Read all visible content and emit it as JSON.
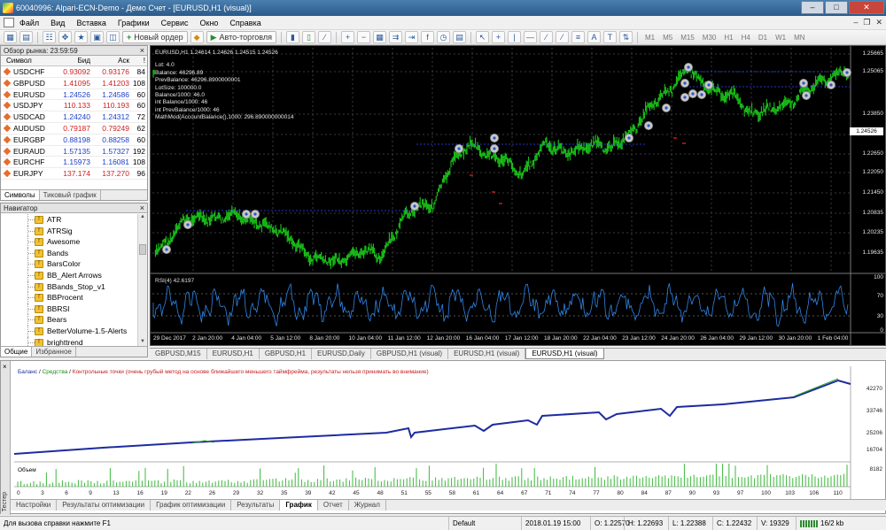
{
  "title_bar": {
    "title": "60040996: Alpari-ECN-Demo - Демо Счет - [EURUSD,H1 (visual)]"
  },
  "menu": [
    "Файл",
    "Вид",
    "Вставка",
    "Графики",
    "Сервис",
    "Окно",
    "Справка"
  ],
  "toolbar": {
    "new_order": "Новый ордер",
    "auto_trading": "Авто-торговля",
    "timeframes": [
      "M1",
      "M5",
      "M15",
      "M30",
      "H1",
      "H4",
      "D1",
      "W1",
      "MN"
    ]
  },
  "market_watch": {
    "title": "Обзор рынка: 23:59:59",
    "headers": {
      "symbol": "Символ",
      "bid": "Бид",
      "ask": "Аск",
      "spread": "!"
    },
    "rows": [
      {
        "symbol": "USDCHF",
        "bid": "0.93092",
        "ask": "0.93176",
        "spread": "84",
        "dir": "down"
      },
      {
        "symbol": "GBPUSD",
        "bid": "1.41095",
        "ask": "1.41203",
        "spread": "108",
        "dir": "down"
      },
      {
        "symbol": "EURUSD",
        "bid": "1.24526",
        "ask": "1.24586",
        "spread": "60",
        "dir": "up"
      },
      {
        "symbol": "USDJPY",
        "bid": "110.133",
        "ask": "110.193",
        "spread": "60",
        "dir": "down"
      },
      {
        "symbol": "USDCAD",
        "bid": "1.24240",
        "ask": "1.24312",
        "spread": "72",
        "dir": "up"
      },
      {
        "symbol": "AUDUSD",
        "bid": "0.79187",
        "ask": "0.79249",
        "spread": "62",
        "dir": "down"
      },
      {
        "symbol": "EURGBP",
        "bid": "0.88198",
        "ask": "0.88258",
        "spread": "60",
        "dir": "up"
      },
      {
        "symbol": "EURAUD",
        "bid": "1.57135",
        "ask": "1.57327",
        "spread": "192",
        "dir": "up"
      },
      {
        "symbol": "EURCHF",
        "bid": "1.15973",
        "ask": "1.16081",
        "spread": "108",
        "dir": "up"
      },
      {
        "symbol": "EURJPY",
        "bid": "137.174",
        "ask": "137.270",
        "spread": "96",
        "dir": "down"
      }
    ],
    "tabs": [
      "Символы",
      "Тиковый график"
    ]
  },
  "navigator": {
    "title": "Навигатор",
    "items": [
      "ATR",
      "ATRSig",
      "Awesome",
      "Bands",
      "BarsColor",
      "BB_Alert Arrows",
      "BBands_Stop_v1",
      "BBProcent",
      "BBRSI",
      "Bears",
      "BetterVolume-1.5-Alerts",
      "brighttrend"
    ],
    "tabs": [
      "Общие",
      "Избранное"
    ]
  },
  "chart": {
    "header": "EURUSD,H1  1.24614 1.24626 1.24515 1.24526",
    "info_lines": [
      "Lot: 4.0",
      "Balance: 46296.89",
      "PrevBalance: 46296.8900000001",
      "LotSize: 100000.0",
      "Balance/1000: 46.0",
      "int Balance/1000: 46",
      "int PrevBalance/1000: 46",
      "MathMod(AccountBalance(),1000: 296.890000000014"
    ],
    "rsi_label": "RSI(4) 42.6197",
    "price_labels": [
      "1.25665",
      "1.25065",
      "1.23850",
      "1.23245",
      "1.22650",
      "1.22050",
      "1.21450",
      "1.20835",
      "1.20235",
      "1.19635"
    ],
    "current_price": "1.24526",
    "rsi_scale": [
      "100",
      "70",
      "30",
      "0"
    ],
    "time_labels": [
      "29 Dec 2017",
      "2 Jan 20:00",
      "4 Jan 04:00",
      "5 Jan 12:00",
      "8 Jan 20:00",
      "10 Jan 04:00",
      "11 Jan 12:00",
      "12 Jan 20:00",
      "16 Jan 04:00",
      "17 Jan 12:00",
      "18 Jan 20:00",
      "22 Jan 04:00",
      "23 Jan 12:00",
      "24 Jan 20:00",
      "26 Jan 04:00",
      "29 Jan 12:00",
      "30 Jan 20:00",
      "1 Feb 04:00"
    ],
    "colors": {
      "candles": "#19c419",
      "rsi": "#2f86e8",
      "grid": "#3a3a3a"
    }
  },
  "chart_tabs": [
    "GBPUSD,M15",
    "EURUSD,H1",
    "GBPUSD,H1",
    "EURUSD,Daily",
    "GBPUSD,H1 (visual)",
    "EURUSD,H1 (visual)",
    "EURUSD,H1 (visual)"
  ],
  "chart_tabs_active": 6,
  "tester": {
    "side_label": "Тестер",
    "legend_balance": "Баланс",
    "legend_sep1": " / ",
    "legend_equity": "Средства",
    "legend_sep2": " / ",
    "legend_note": "Контрольные точки (очень грубый метод на основе ближайшего меньшего таймфрейма, результаты нельзя принимать во внимание)",
    "volume_label": "Объем",
    "balance_scale": [
      "42270",
      "33746",
      "25206",
      "16704",
      "8182"
    ],
    "x_numbers": [
      "0",
      "3",
      "6",
      "9",
      "13",
      "16",
      "19",
      "22",
      "26",
      "29",
      "32",
      "35",
      "39",
      "42",
      "45",
      "48",
      "51",
      "55",
      "58",
      "61",
      "64",
      "67",
      "71",
      "74",
      "77",
      "80",
      "84",
      "87",
      "90",
      "93",
      "97",
      "100",
      "103",
      "106",
      "110"
    ],
    "tabs": [
      "Настройки",
      "Результаты оптимизации",
      "График оптимизации",
      "Результаты",
      "График",
      "Отчет",
      "Журнал"
    ],
    "active_tab": 4,
    "colors": {
      "balance": "#1d2ba0",
      "equity": "#2fa32f"
    }
  },
  "status_bar": {
    "help": "Для вызова справки нажмите F1",
    "profile": "Default",
    "datetime": "2018.01.19 15:00",
    "open": "O: 1.22570",
    "high": "H: 1.22693",
    "low": "L: 1.22388",
    "close": "C: 1.22432",
    "volume": "V: 19329",
    "traffic": "16/2 kb"
  }
}
